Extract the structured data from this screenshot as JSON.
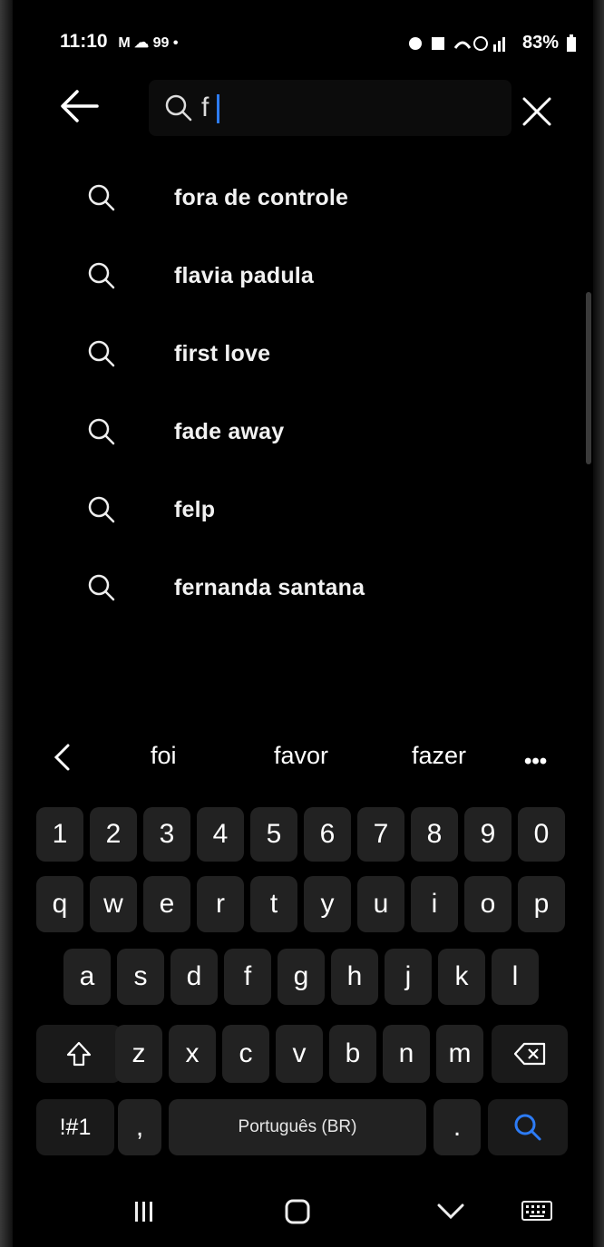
{
  "status_bar": {
    "time": "11:10",
    "left_icons": "M ☁ 99 •",
    "battery": "83%"
  },
  "search": {
    "query": "f",
    "placeholder": ""
  },
  "suggestions": [
    "fora de controle",
    "flavia padula",
    "first love",
    "fade away",
    "felp",
    "fernanda santana"
  ],
  "keyboard": {
    "word_suggestions": [
      "foi",
      "favor",
      "fazer"
    ],
    "more_label": "•••",
    "number_row": [
      "1",
      "2",
      "3",
      "4",
      "5",
      "6",
      "7",
      "8",
      "9",
      "0"
    ],
    "row1": [
      "q",
      "w",
      "e",
      "r",
      "t",
      "y",
      "u",
      "i",
      "o",
      "p"
    ],
    "row2": [
      "a",
      "s",
      "d",
      "f",
      "g",
      "h",
      "j",
      "k",
      "l"
    ],
    "row3": [
      "z",
      "x",
      "c",
      "v",
      "b",
      "n",
      "m"
    ],
    "symbols_label": "!#1",
    "comma_label": ",",
    "space_label": "Português (BR)",
    "period_label": ".",
    "accent_color": "#2d7cf6"
  },
  "icons": {
    "back": "back-arrow-icon",
    "search": "search-icon",
    "close": "close-icon",
    "shift": "shift-icon",
    "backspace": "backspace-icon",
    "recents": "recents-icon",
    "home": "home-icon",
    "nav_back": "chevron-down-icon",
    "keyboard_toggle": "keyboard-icon"
  }
}
